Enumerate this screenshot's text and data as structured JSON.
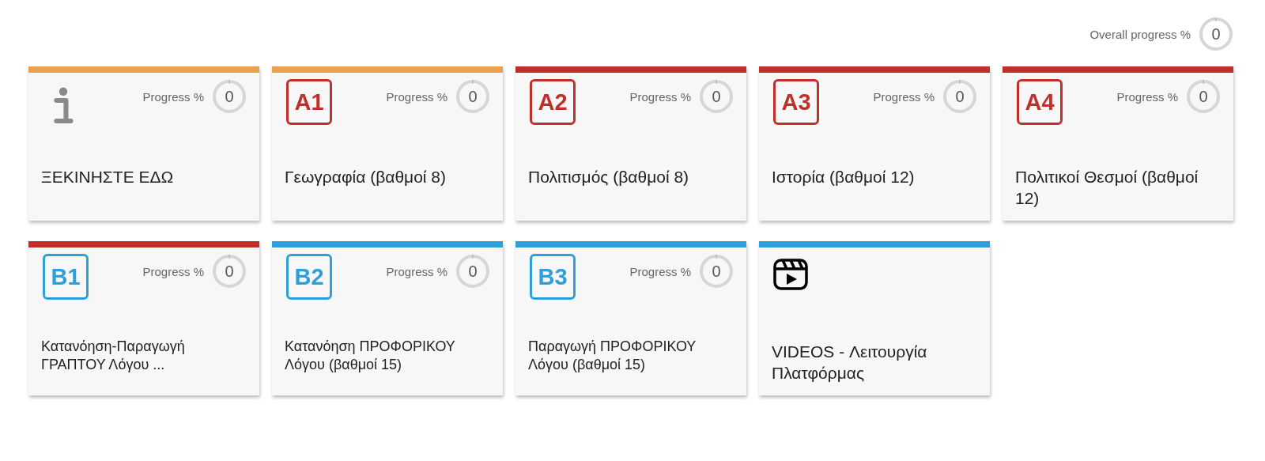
{
  "overall": {
    "label": "Overall progress %",
    "value": "0",
    "level": 0
  },
  "cards": [
    {
      "kind": "info",
      "color": "#e8a24e",
      "title": "ΞΕΚΙΝΗΣΤΕ ΕΔΩ",
      "progress": {
        "label": "Progress %",
        "value": "0",
        "level": 0
      }
    },
    {
      "kind": "badge",
      "color": "#e8a24e",
      "badge": {
        "text": "A1",
        "color": "#c0302b"
      },
      "title": "Γεωγραφία (βαθμοί 8)",
      "progress": {
        "label": "Progress %",
        "value": "0",
        "level": 0
      }
    },
    {
      "kind": "badge",
      "color": "#c0302b",
      "badge": {
        "text": "A2",
        "color": "#c0302b"
      },
      "title": "Πολιτισμός (βαθμοί 8)",
      "progress": {
        "label": "Progress %",
        "value": "0",
        "level": 0
      }
    },
    {
      "kind": "badge",
      "color": "#c0302b",
      "badge": {
        "text": "A3",
        "color": "#c0302b"
      },
      "title": "Ιστορία (βαθμοί 12)",
      "progress": {
        "label": "Progress %",
        "value": "0",
        "level": 0
      }
    },
    {
      "kind": "badge",
      "color": "#c0302b",
      "badge": {
        "text": "A4",
        "color": "#c0302b"
      },
      "title": "Πολιτικοί Θεσμοί (βαθμοί 12)",
      "progress": {
        "label": "Progress %",
        "value": "0",
        "level": 0
      }
    },
    {
      "kind": "badge",
      "color": "#c0302b",
      "badge": {
        "text": "B1",
        "color": "#2f9fd8"
      },
      "title": "Κατανόηση-Παραγωγή ΓΡΑΠΤΟΥ Λόγου ...",
      "small": true,
      "progress": {
        "label": "Progress %",
        "value": "0",
        "level": 0
      }
    },
    {
      "kind": "badge",
      "color": "#2f9fd8",
      "badge": {
        "text": "B2",
        "color": "#2f9fd8"
      },
      "title": "Κατανόηση ΠΡΟΦΟΡΙΚΟΥ Λόγου (βαθμοί 15)",
      "small": true,
      "progress": {
        "label": "Progress %",
        "value": "0",
        "level": 0
      }
    },
    {
      "kind": "badge",
      "color": "#2f9fd8",
      "badge": {
        "text": "B3",
        "color": "#2f9fd8"
      },
      "title": "Παραγωγή ΠΡΟΦΟΡΙΚΟΥ Λόγου (βαθμοί 15)",
      "small": true,
      "progress": {
        "label": "Progress %",
        "value": "0",
        "level": 0
      }
    },
    {
      "kind": "video",
      "color": "#2f9fd8",
      "title": "VIDEOS - Λειτουργία Πλατφόρμας"
    }
  ]
}
